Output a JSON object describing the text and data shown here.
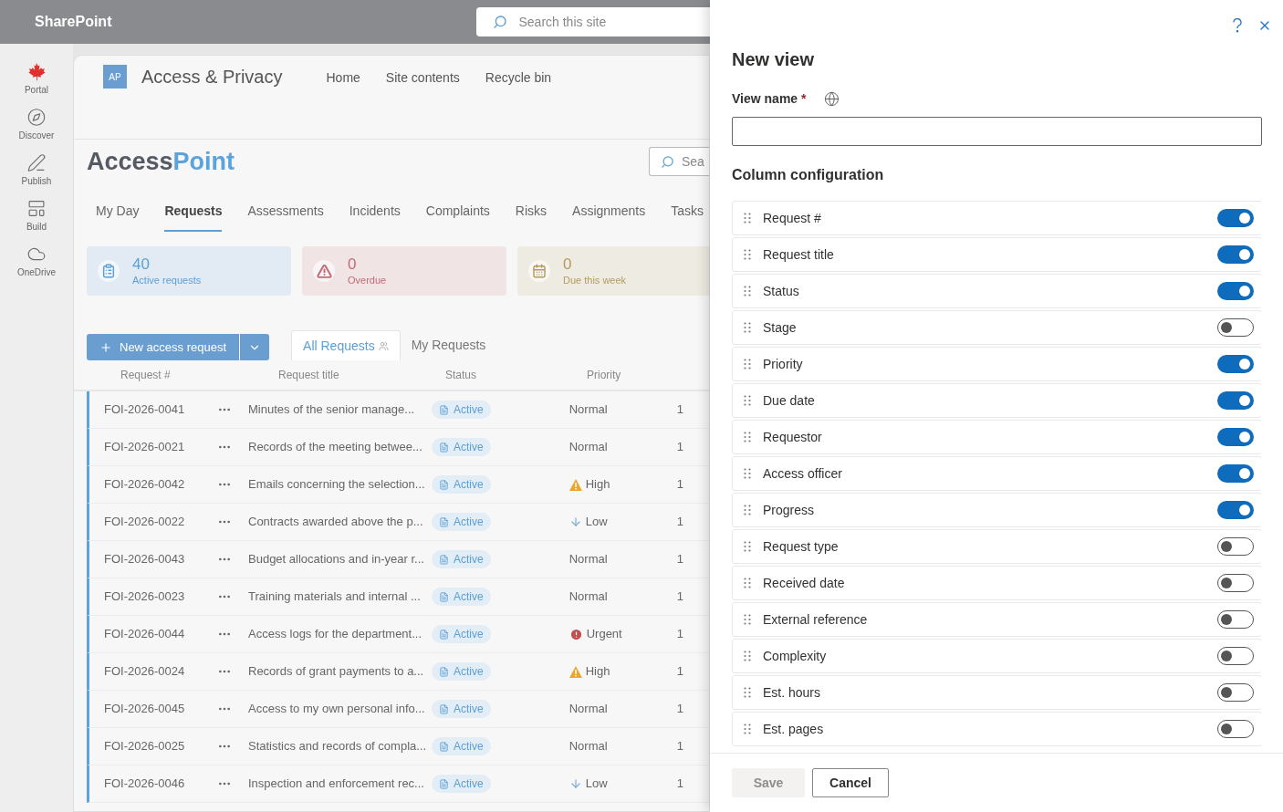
{
  "suite_bar": {
    "app_name": "SharePoint",
    "search": {
      "placeholder": "Search this site"
    }
  },
  "app_rail": [
    {
      "label": "Portal",
      "kind": "portal"
    },
    {
      "label": "Discover",
      "kind": "discover"
    },
    {
      "label": "Publish",
      "kind": "publish"
    },
    {
      "label": "Build",
      "kind": "build"
    },
    {
      "label": "OneDrive",
      "kind": "onedrive"
    }
  ],
  "site_header": {
    "logo": "AP",
    "title": "Access & Privacy",
    "links": [
      "Home",
      "Site contents",
      "Recycle bin"
    ]
  },
  "app_title": {
    "part_1": "Access",
    "part_2": "Point"
  },
  "page_search": {
    "placeholder": "Sea"
  },
  "tabs": [
    {
      "label": "My Day",
      "selected": false
    },
    {
      "label": "Requests",
      "selected": true
    },
    {
      "label": "Assessments",
      "selected": false
    },
    {
      "label": "Incidents",
      "selected": false
    },
    {
      "label": "Complaints",
      "selected": false
    },
    {
      "label": "Risks",
      "selected": false
    },
    {
      "label": "Assignments",
      "selected": false
    },
    {
      "label": "Tasks",
      "selected": false
    }
  ],
  "stat_cards": [
    {
      "kind": "active",
      "value": "40",
      "label": "Active requests",
      "color": "#5a9fd6"
    },
    {
      "kind": "overdue",
      "value": "0",
      "label": "Overdue",
      "color": "#c36b74"
    },
    {
      "kind": "due",
      "value": "0",
      "label": "Due this week",
      "color": "#b59a5e"
    }
  ],
  "new_button": {
    "label": "New access request"
  },
  "view_tabs": [
    {
      "label": "All Requests",
      "selected": true
    },
    {
      "label": "My Requests",
      "selected": false
    }
  ],
  "table": {
    "columns": [
      "Request #",
      "Request title",
      "Status",
      "Priority"
    ],
    "rows": [
      {
        "id": "FOI-2026-0041",
        "title": "Minutes of the senior manage...",
        "status": "Active",
        "priority": {
          "text": "Normal",
          "kind": "normal"
        },
        "column_5": "1"
      },
      {
        "id": "FOI-2026-0021",
        "title": "Records of the meeting betwee...",
        "status": "Active",
        "priority": {
          "text": "Normal",
          "kind": "normal"
        },
        "column_5": "1"
      },
      {
        "id": "FOI-2026-0042",
        "title": "Emails concerning the selection...",
        "status": "Active",
        "priority": {
          "text": "High",
          "kind": "high"
        },
        "column_5": "1"
      },
      {
        "id": "FOI-2026-0022",
        "title": "Contracts awarded above the p...",
        "status": "Active",
        "priority": {
          "text": "Low",
          "kind": "low"
        },
        "column_5": "1"
      },
      {
        "id": "FOI-2026-0043",
        "title": "Budget allocations and in-year r...",
        "status": "Active",
        "priority": {
          "text": "Normal",
          "kind": "normal"
        },
        "column_5": "1"
      },
      {
        "id": "FOI-2026-0023",
        "title": "Training materials and internal ...",
        "status": "Active",
        "priority": {
          "text": "Normal",
          "kind": "normal"
        },
        "column_5": "1"
      },
      {
        "id": "FOI-2026-0044",
        "title": "Access logs for the department...",
        "status": "Active",
        "priority": {
          "text": "Urgent",
          "kind": "urgent"
        },
        "column_5": "1"
      },
      {
        "id": "FOI-2026-0024",
        "title": "Records of grant payments to a...",
        "status": "Active",
        "priority": {
          "text": "High",
          "kind": "high"
        },
        "column_5": "1"
      },
      {
        "id": "FOI-2026-0045",
        "title": "Access to my own personal info...",
        "status": "Active",
        "priority": {
          "text": "Normal",
          "kind": "normal"
        },
        "column_5": "1"
      },
      {
        "id": "FOI-2026-0025",
        "title": "Statistics and records of compla...",
        "status": "Active",
        "priority": {
          "text": "Normal",
          "kind": "normal"
        },
        "column_5": "1"
      },
      {
        "id": "FOI-2026-0046",
        "title": "Inspection and enforcement rec...",
        "status": "Active",
        "priority": {
          "text": "Low",
          "kind": "low"
        },
        "column_5": "1"
      }
    ]
  },
  "panel": {
    "title": "New view",
    "view_name": {
      "label": "View name",
      "required_mark": "*"
    },
    "section_title": "Column configuration",
    "columns": [
      {
        "label": "Request #",
        "on": true
      },
      {
        "label": "Request title",
        "on": true
      },
      {
        "label": "Status",
        "on": true
      },
      {
        "label": "Stage",
        "on": false
      },
      {
        "label": "Priority",
        "on": true
      },
      {
        "label": "Due date",
        "on": true
      },
      {
        "label": "Requestor",
        "on": true
      },
      {
        "label": "Access officer",
        "on": true
      },
      {
        "label": "Progress",
        "on": true
      },
      {
        "label": "Request type",
        "on": false
      },
      {
        "label": "Received date",
        "on": false
      },
      {
        "label": "External reference",
        "on": false
      },
      {
        "label": "Complexity",
        "on": false
      },
      {
        "label": "Est. hours",
        "on": false
      },
      {
        "label": "Est. pages",
        "on": false
      }
    ],
    "save": {
      "label": "Save",
      "disabled": true
    },
    "cancel": {
      "label": "Cancel"
    }
  }
}
